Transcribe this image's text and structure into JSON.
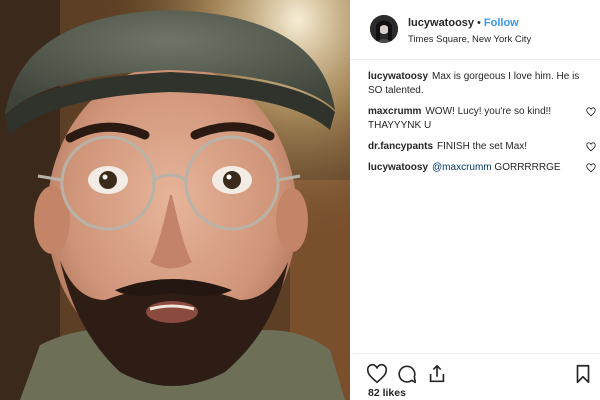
{
  "post": {
    "username": "lucywatoosy",
    "separator": "•",
    "follow_label": "Follow",
    "location": "Times Square, New York City"
  },
  "comments": [
    {
      "user": "lucywatoosy",
      "text": "Max is gorgeous I love him. He is SO talented.",
      "mention": "",
      "liked_icon": false
    },
    {
      "user": "maxcrumm",
      "text": "WOW! Lucy! you're so kind!! THAYYYNK U",
      "mention": "",
      "liked_icon": true
    },
    {
      "user": "dr.fancypants",
      "text": "FINISH the set Max!",
      "mention": "",
      "liked_icon": true
    },
    {
      "user": "lucywatoosy",
      "text": "GORRRRRGE",
      "mention": "@maxcrumm",
      "liked_icon": true
    }
  ],
  "actions": {
    "like_icon": "heart-icon",
    "comment_icon": "comment-icon",
    "share_icon": "share-icon",
    "save_icon": "bookmark-icon"
  },
  "likes_label": "82 likes",
  "colors": {
    "link_blue": "#3897f0",
    "mention_blue": "#003569",
    "text": "#262626"
  }
}
